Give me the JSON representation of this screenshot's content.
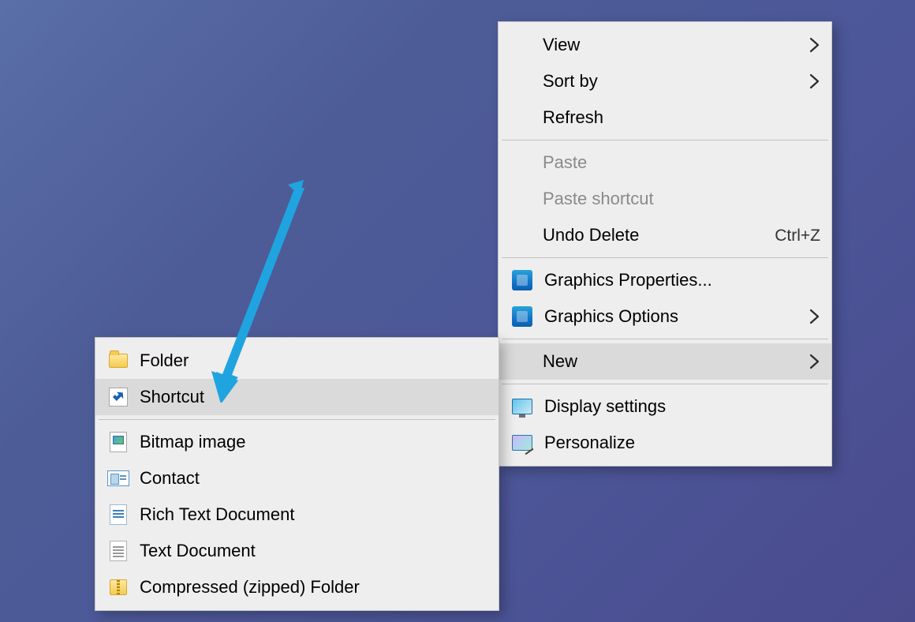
{
  "primary_menu": {
    "view": {
      "label": "View"
    },
    "sort_by": {
      "label": "Sort by"
    },
    "refresh": {
      "label": "Refresh"
    },
    "paste": {
      "label": "Paste"
    },
    "paste_shortcut": {
      "label": "Paste shortcut"
    },
    "undo_delete": {
      "label": "Undo Delete",
      "shortcut": "Ctrl+Z"
    },
    "gfx_properties": {
      "label": "Graphics Properties..."
    },
    "gfx_options": {
      "label": "Graphics Options"
    },
    "new": {
      "label": "New"
    },
    "display_settings": {
      "label": "Display settings"
    },
    "personalize": {
      "label": "Personalize"
    }
  },
  "new_submenu": {
    "folder": {
      "label": "Folder"
    },
    "shortcut": {
      "label": "Shortcut"
    },
    "bitmap": {
      "label": "Bitmap image"
    },
    "contact": {
      "label": "Contact"
    },
    "rtf": {
      "label": "Rich Text Document"
    },
    "txt": {
      "label": "Text Document"
    },
    "zip": {
      "label": "Compressed (zipped) Folder"
    }
  },
  "annotation": {
    "color": "#20a4e0",
    "points_to": "new_submenu.shortcut"
  }
}
